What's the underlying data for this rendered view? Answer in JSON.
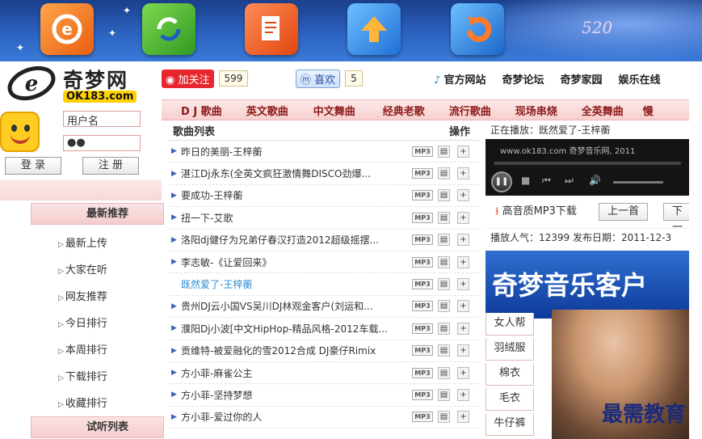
{
  "banner": {
    "deco_text": "520"
  },
  "logo": {
    "name": "奇梦网",
    "domain": "OK183.com"
  },
  "login": {
    "username_value": "用户名",
    "password_value": "●●",
    "login_label": "登 录",
    "register_label": "注 册"
  },
  "sidebar": {
    "section1": "最新推荐",
    "items": [
      "最新上传",
      "大家在听",
      "网友推荐",
      "今日排行",
      "本周排行",
      "下载排行",
      "收藏排行"
    ],
    "section2": "试听列表"
  },
  "social": {
    "follow_label": "加关注",
    "follow_count": "599",
    "like_label": "喜欢",
    "like_count": "5"
  },
  "toplinks": [
    "官方网站",
    "奇梦论坛",
    "奇梦家园",
    "娱乐在线"
  ],
  "categories": [
    "D J 歌曲",
    "英文歌曲",
    "中文舞曲",
    "经典老歌",
    "流行歌曲",
    "现场串烧",
    "全英舞曲",
    "慢"
  ],
  "song_list": {
    "header_title": "歌曲列表",
    "header_action": "操作",
    "mp3_badge": "MP3",
    "songs": [
      "昨日的美丽-王梓蘅",
      "湛江Dj永东(全英文疯狂激情舞DISCO劲爆...",
      "要成功-王梓蘅",
      "扭一下-艾歌",
      "洛阳dj健仔为兄弟仔春汉打造2012超级摇摆...",
      "李志敏-《让爱回来》",
      "既然爱了-王梓蘅",
      "贵州DJ云小国VS吴川DJ林观金客户(刘运和...",
      "濮阳Dj小波[中文HipHop-精品风格-2012车载...",
      "贡维特-被爱融化的雪2012合成 DJ豪仔Rimix",
      "方小菲-麻雀公主",
      "方小菲-坚持梦想",
      "方小菲-爱过你的人"
    ],
    "active_index": 6
  },
  "player": {
    "now_playing": "正在播放：既然爱了-王梓蘅",
    "url_text": "www.ok183.com 奇梦音乐网, 2011",
    "download_label": "高音质MP3下载",
    "prev_label": "上一首",
    "next_label": "下一",
    "stats": "播放人气：12399   发布日期：2011-12-3",
    "ad_text": "奇梦音乐客户"
  },
  "tags": [
    "女人帮",
    "羽绒服",
    "棉衣",
    "毛衣",
    "牛仔裤"
  ],
  "watermark": "最需教育"
}
